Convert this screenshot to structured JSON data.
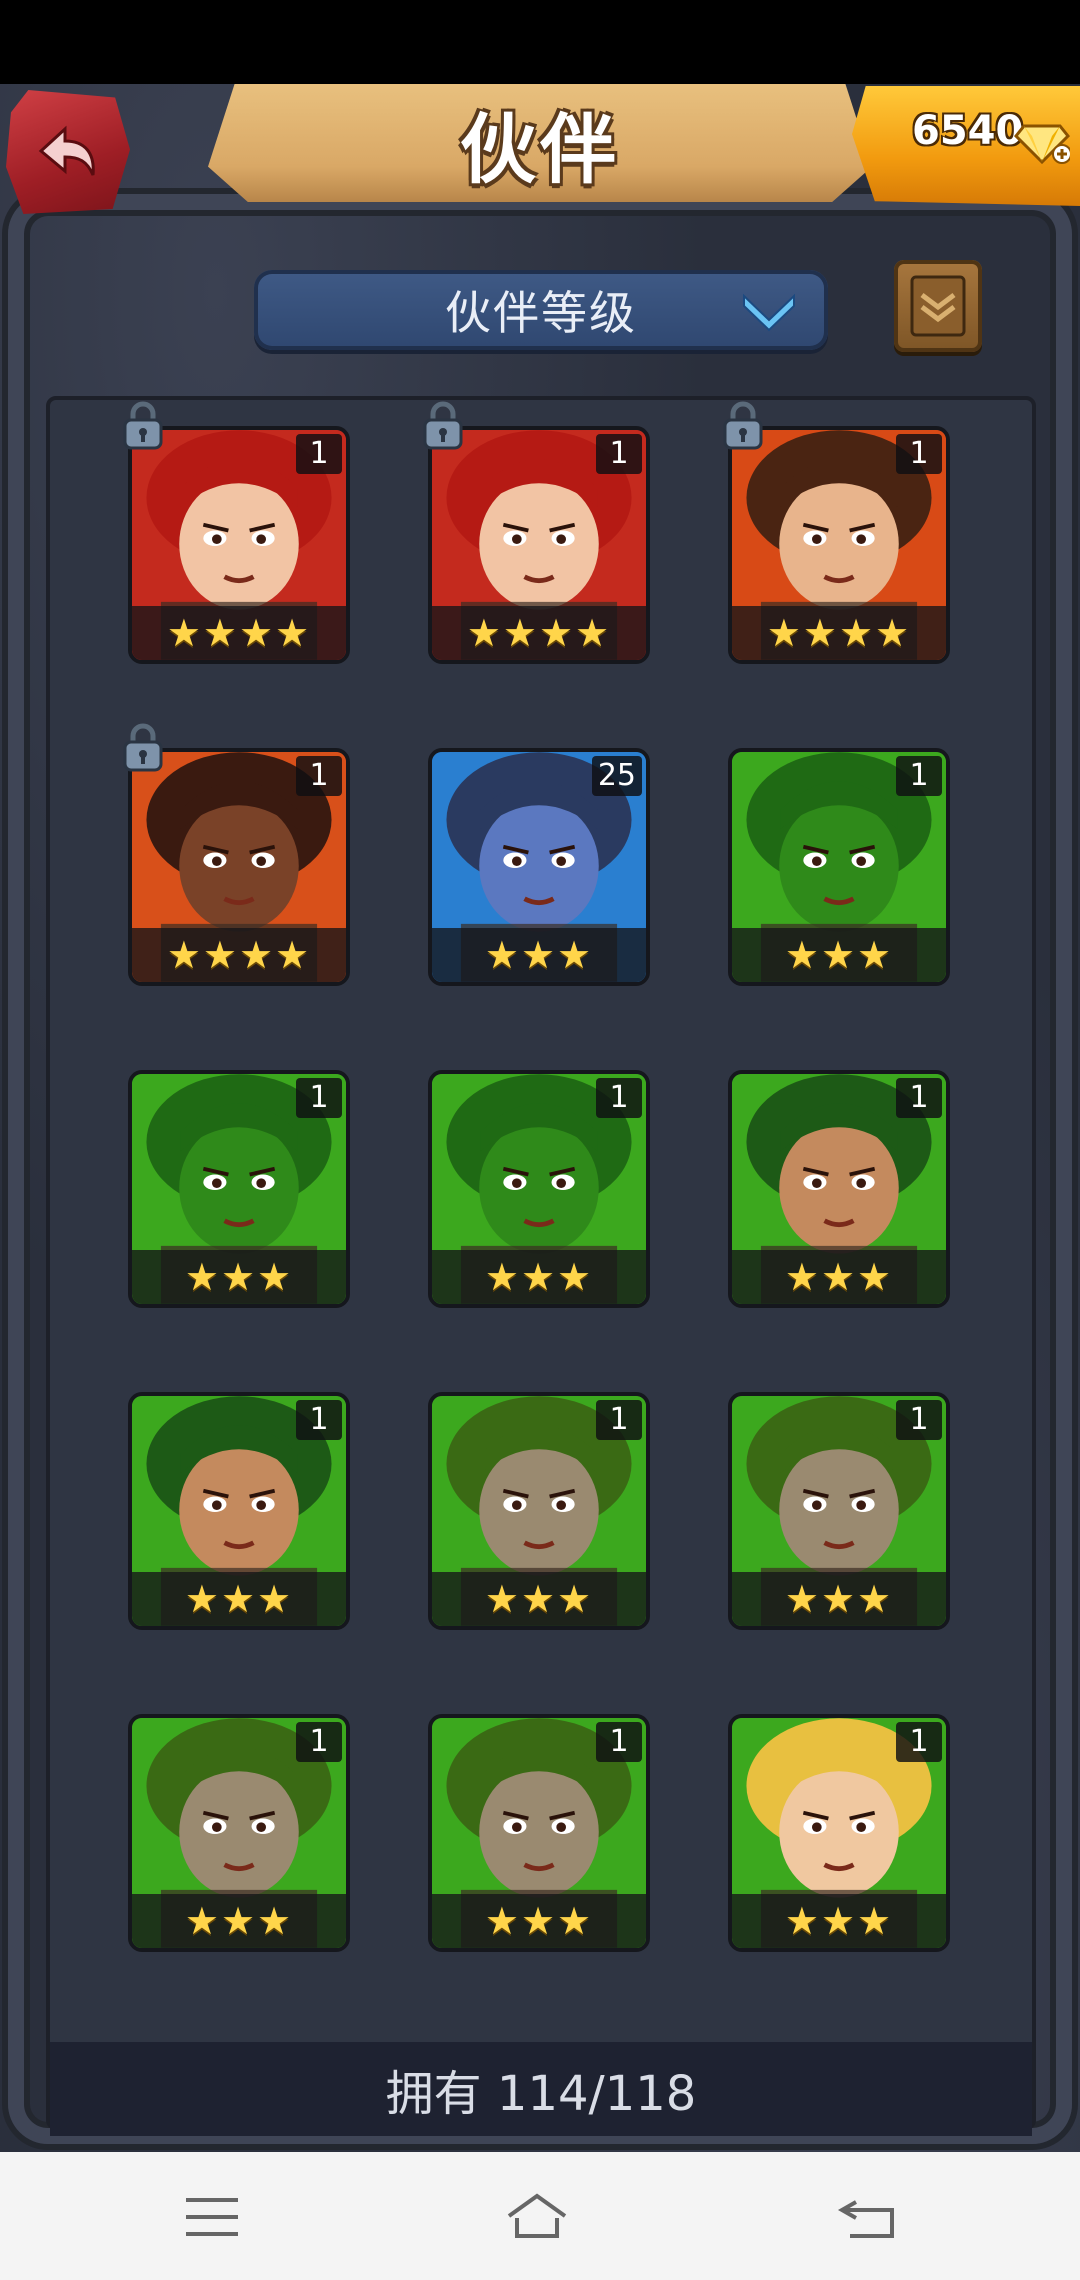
{
  "header": {
    "title": "伙伴",
    "gems": "6540"
  },
  "sort": {
    "label": "伙伴等级"
  },
  "heroes": [
    {
      "level": "1",
      "stars": "★★★★",
      "locked": true,
      "bg": "#c42a1e",
      "hair": "#b51a14",
      "skin": "#f2c4a4"
    },
    {
      "level": "1",
      "stars": "★★★★",
      "locked": true,
      "bg": "#c42a1e",
      "hair": "#b51a14",
      "skin": "#f2c4a4"
    },
    {
      "level": "1",
      "stars": "★★★★",
      "locked": true,
      "bg": "#d84a16",
      "hair": "#4a2412",
      "skin": "#e8b48c"
    },
    {
      "level": "1",
      "stars": "★★★★",
      "locked": true,
      "bg": "#d8501a",
      "hair": "#3a1a10",
      "skin": "#7a4228"
    },
    {
      "level": "25",
      "stars": "★★★",
      "locked": false,
      "bg": "#2a7fd0",
      "hair": "#2a3a60",
      "skin": "#5b78c0"
    },
    {
      "level": "1",
      "stars": "★★★",
      "locked": false,
      "bg": "#3ca81e",
      "hair": "#1f6a14",
      "skin": "#2f8a1a"
    },
    {
      "level": "1",
      "stars": "★★★",
      "locked": false,
      "bg": "#3ca81e",
      "hair": "#1f6a14",
      "skin": "#2f8a1a"
    },
    {
      "level": "1",
      "stars": "★★★",
      "locked": false,
      "bg": "#3ca81e",
      "hair": "#1f6a14",
      "skin": "#2f8a1a"
    },
    {
      "level": "1",
      "stars": "★★★",
      "locked": false,
      "bg": "#3ca81e",
      "hair": "#1d5a16",
      "skin": "#c48a5e"
    },
    {
      "level": "1",
      "stars": "★★★",
      "locked": false,
      "bg": "#3ca81e",
      "hair": "#1d5a16",
      "skin": "#c48a5e"
    },
    {
      "level": "1",
      "stars": "★★★",
      "locked": false,
      "bg": "#3ca81e",
      "hair": "#3a6a14",
      "skin": "#9a8a70"
    },
    {
      "level": "1",
      "stars": "★★★",
      "locked": false,
      "bg": "#3ca81e",
      "hair": "#3a6a14",
      "skin": "#9a8a70"
    },
    {
      "level": "1",
      "stars": "★★★",
      "locked": false,
      "bg": "#3ca81e",
      "hair": "#3a6a14",
      "skin": "#9a8a70"
    },
    {
      "level": "1",
      "stars": "★★★",
      "locked": false,
      "bg": "#3ca81e",
      "hair": "#3a6a14",
      "skin": "#9a8a70"
    },
    {
      "level": "1",
      "stars": "★★★",
      "locked": false,
      "bg": "#3ca81e",
      "hair": "#e8c040",
      "skin": "#f0c8a0"
    }
  ],
  "footer": {
    "owned": "拥有 114/118"
  },
  "icons": {
    "back": "back-arrow-icon",
    "gem": "diamond-icon",
    "chevron": "chevron-down-icon",
    "book": "book-icon",
    "lock": "lock-icon",
    "menu": "menu-icon",
    "home": "home-icon",
    "return": "return-icon"
  }
}
